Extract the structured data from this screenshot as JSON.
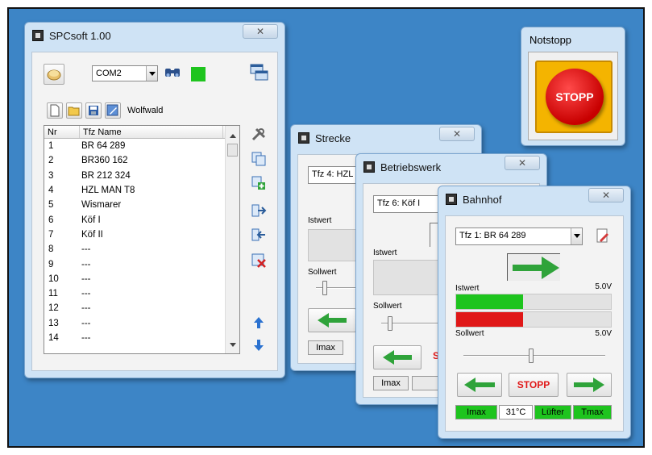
{
  "colors": {
    "desktop": "#3d85c6",
    "green": "#1ec41e",
    "red": "#e01818",
    "stop_text": "#e01818"
  },
  "spcsoft": {
    "title": "SPCsoft 1.00",
    "close_glyph": "✕",
    "port_value": "COM2",
    "layout_name": "Wolfwald",
    "columns": [
      "Nr",
      "Tfz Name"
    ],
    "rows": [
      {
        "nr": "1",
        "name": "BR 64 289"
      },
      {
        "nr": "2",
        "name": "BR360 162"
      },
      {
        "nr": "3",
        "name": "BR 212 324"
      },
      {
        "nr": "4",
        "name": "HZL MAN T8"
      },
      {
        "nr": "5",
        "name": "Wismarer"
      },
      {
        "nr": "6",
        "name": "Köf I"
      },
      {
        "nr": "7",
        "name": "Köf II"
      },
      {
        "nr": "8",
        "name": "---"
      },
      {
        "nr": "9",
        "name": "---"
      },
      {
        "nr": "10",
        "name": "---"
      },
      {
        "nr": "11",
        "name": "---"
      },
      {
        "nr": "12",
        "name": "---"
      },
      {
        "nr": "13",
        "name": "---"
      },
      {
        "nr": "14",
        "name": "---"
      }
    ]
  },
  "notstopp": {
    "title": "Notstopp",
    "button_label": "STOPP"
  },
  "strecke": {
    "title": "Strecke",
    "close_glyph": "✕",
    "tfz_value": "Tfz 4:  HZL",
    "istwert_label": "Istwert",
    "sollwert_label": "Sollwert",
    "imax_label": "Imax"
  },
  "betriebswerk": {
    "title": "Betriebswerk",
    "close_glyph": "✕",
    "tfz_value": "Tfz 6:  Köf I",
    "istwert_label": "Istwert",
    "sollwert_label": "Sollwert",
    "imax_label": "Imax",
    "stop_partial": "S"
  },
  "bahnhof": {
    "title": "Bahnhof",
    "close_glyph": "✕",
    "tfz_value": "Tfz 1:  BR 64 289",
    "istwert_label": "Istwert",
    "istwert_value": "5.0V",
    "sollwert_label": "Sollwert",
    "sollwert_value": "5.0V",
    "istwert_level": 0.43,
    "sollwert_level": 0.43,
    "slider_level": 0.48,
    "stop_label": "STOPP",
    "status": {
      "imax": "Imax",
      "temp": "31°C",
      "fan": "Lüfter",
      "tmax": "Tmax"
    }
  }
}
